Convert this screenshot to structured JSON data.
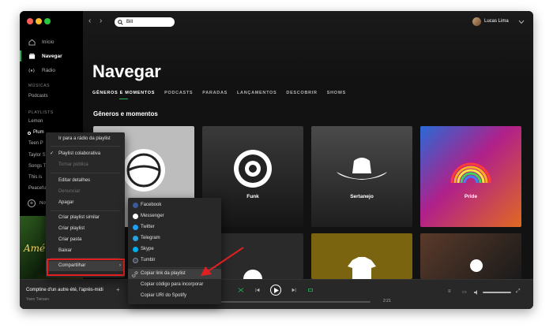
{
  "window": {
    "traffic_lights": [
      "#ff5f57",
      "#febc2e",
      "#28c840"
    ]
  },
  "sidebar": {
    "nav": [
      {
        "label": "Início",
        "icon": "home-icon"
      },
      {
        "label": "Navegar",
        "icon": "browse-icon"
      },
      {
        "label": "Rádio",
        "icon": "radio-icon"
      }
    ],
    "library_label": "MÚSICAS",
    "library_items": [
      "Podcasts"
    ],
    "playlists_label": "PLAYLISTS",
    "playlists": [
      "Lemon",
      "Plum",
      "Teen P",
      "Taylor S",
      "Songs T",
      "This is",
      "Peacefu"
    ],
    "new_playlist_label": "Nova playlist"
  },
  "topbar": {
    "search_value": "Bill",
    "user_name": "Lucas Lima"
  },
  "main": {
    "title": "Navegar",
    "tabs": [
      "GÊNEROS E MOMENTOS",
      "PODCASTS",
      "PARADAS",
      "LANÇAMENTOS",
      "DESCOBRIR",
      "SHOWS"
    ],
    "section_title": "Gêneros e momentos",
    "cards": [
      {
        "label": "",
        "bg": "#b9b9b9"
      },
      {
        "label": "Funk",
        "bg": "#2b2b2b"
      },
      {
        "label": "Sertanejo",
        "bg": "#3a3a3a"
      },
      {
        "label": "Pride",
        "bg": "#7a1e8a"
      }
    ]
  },
  "context_menu": {
    "items": [
      {
        "label": "Ir para a rádio da playlist",
        "disabled": false
      },
      {
        "label": "Playlist colaborativa",
        "disabled": false,
        "checked": true
      },
      {
        "label": "Tornar pública",
        "disabled": true
      },
      {
        "label": "Editar detalhes",
        "disabled": false
      },
      {
        "label": "Denunciar",
        "disabled": true
      },
      {
        "label": "Apagar",
        "disabled": false
      },
      {
        "label": "Criar playlist similar",
        "disabled": false
      },
      {
        "label": "Criar playlist",
        "disabled": false
      },
      {
        "label": "Criar pasta",
        "disabled": false
      },
      {
        "label": "Baixar",
        "disabled": false
      },
      {
        "label": "Compartilhar",
        "disabled": false
      }
    ]
  },
  "share_menu": {
    "items": [
      {
        "label": "Facebook",
        "icon": "facebook-icon",
        "color": "#3b5998"
      },
      {
        "label": "Messenger",
        "icon": "messenger-icon",
        "color": "#ffffff"
      },
      {
        "label": "Twitter",
        "icon": "twitter-icon",
        "color": "#1da1f2"
      },
      {
        "label": "Telegram",
        "icon": "telegram-icon",
        "color": "#2aa3df"
      },
      {
        "label": "Skype",
        "icon": "skype-icon",
        "color": "#00aff0"
      },
      {
        "label": "Tumblr",
        "icon": "tumblr-icon",
        "color": "#36465d"
      },
      {
        "label": "Copiar link da playlist",
        "icon": "link-icon",
        "color": "#b3b3b3"
      },
      {
        "label": "Copiar código para incorporar",
        "icon": "",
        "color": ""
      },
      {
        "label": "Copiar URI do Spotify",
        "icon": "",
        "color": ""
      }
    ]
  },
  "player": {
    "track": "Comptine d'un autre été, l'après-midi",
    "artist": "Yann Tiersen",
    "time_total": "2:21"
  },
  "colors": {
    "accent": "#1db954",
    "annotation": "#e02020"
  }
}
